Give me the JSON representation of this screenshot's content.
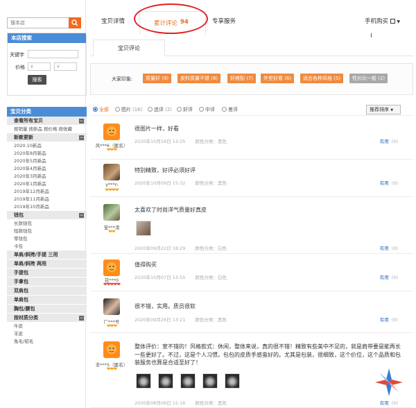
{
  "search": {
    "placeholder": "搜本店"
  },
  "store_search": {
    "title": "本店搜索",
    "keyword_label": "关键字",
    "price_label": "价格",
    "price_from": "¥",
    "price_to": "¥",
    "search_button": "搜索"
  },
  "categories": {
    "title": "宝贝分类",
    "groups": [
      {
        "label": "查看所有宝贝",
        "subs": [
          "按销量",
          "按新品",
          "按价格",
          "按收藏"
        ]
      },
      {
        "label": "新款更新",
        "subs": [
          "2020.10新品",
          "2020年8月新品",
          "2020年5月新品",
          "2020年4月新品",
          "2020年3月新品",
          "2020年1月新品",
          "2019年12月新品",
          "2019年11月新品",
          "2019年10月新品"
        ]
      },
      {
        "label": "钱包",
        "subs": [
          "长款钱包",
          "短款钱包",
          "零钱包",
          "卡包"
        ]
      },
      {
        "label": "单肩/斜挎/手提 三用",
        "subs": []
      },
      {
        "label": "单肩/斜挎 两用",
        "subs": []
      },
      {
        "label": "手提包",
        "subs": []
      },
      {
        "label": "手拿包",
        "subs": []
      },
      {
        "label": "双肩包",
        "subs": []
      },
      {
        "label": "单肩包",
        "subs": []
      },
      {
        "label": "胸包/腰包",
        "subs": []
      },
      {
        "label": "按材质分类",
        "subs": [
          "牛皮",
          "羊皮",
          "兔毛/貂毛"
        ]
      }
    ]
  },
  "tabs": {
    "details": "宝贝详情",
    "reviews": "累计评论",
    "review_count": "94",
    "service": "专享服务",
    "mobile": "手机购买"
  },
  "subtab": "宝贝评论",
  "impressions": {
    "label": "大家印象:",
    "tags": [
      "质量好 (9)",
      "皮料质量不错 (8)",
      "好搭配 (7)",
      "外型好看 (6)",
      "适合各种风格 (5)",
      "性价比一般 (2)"
    ]
  },
  "filter": {
    "options": [
      "全部",
      "图片",
      "追评",
      "好评",
      "中评",
      "差评"
    ],
    "counts": [
      "",
      "(16)",
      "(2)",
      "",
      "",
      ""
    ],
    "sort": "推荐排序"
  },
  "reviews": [
    {
      "user": "风***6（匿名）",
      "hearts": "❤❤❤",
      "text": "很图片一样，好看",
      "date": "2020年10月18日 13:25",
      "spec": "颜色分类：黑色",
      "useful": "有用",
      "useful_count": "(0)"
    },
    {
      "user": "y***n",
      "hearts": "❤❤❤❤",
      "text": "特别精致，好评必须好评",
      "date": "2020年10月09日 15:32",
      "spec": "颜色分类：黑色",
      "useful": "有用",
      "useful_count": "(0)"
    },
    {
      "user": "宝***渚",
      "hearts": "❤❤",
      "text": "太喜欢了时尚洋气质量好真皮",
      "date": "2020年09月22日 18:29",
      "spec": "颜色分类：白色",
      "useful": "有用",
      "useful_count": "(0)"
    },
    {
      "user": "花***0",
      "hearts": "❤❤❤❤❤",
      "text": "值得购买",
      "date": "2020年10月07日 13:55",
      "spec": "颜色分类：白色",
      "useful": "有用",
      "useful_count": "(0)"
    },
    {
      "user": "厂***号",
      "hearts": "❤❤❤",
      "text": "很不错，实用。质员很软",
      "date": "2020年09月26日 13:21",
      "spec": "颜色分类：黑色",
      "useful": "有用",
      "useful_count": "(0)"
    },
    {
      "user": "非***5（匿名）",
      "hearts": "❤❤❤",
      "text": "整体评价：室不错的！风格款式：休闲，整体来说，真的很不错！精致有些美中不足的，就是肩带要是能再长一些更好了。不过，这是个人习惯。包包的皮质手感蛮好的。尤其是包装，很细致，这个价位，这个品质和包装服务也算是合适至好了！",
      "date": "2020年08月08日 15:16",
      "spec": "颜色分类：黑色",
      "useful": "有用",
      "useful_count": "(0)"
    }
  ],
  "colors": {
    "accent": "#f26a1c",
    "tag": "#f08a3e",
    "tag_grey": "#a8a8a8",
    "link": "#2a66c9",
    "header_blue": "#4a8cd6"
  }
}
